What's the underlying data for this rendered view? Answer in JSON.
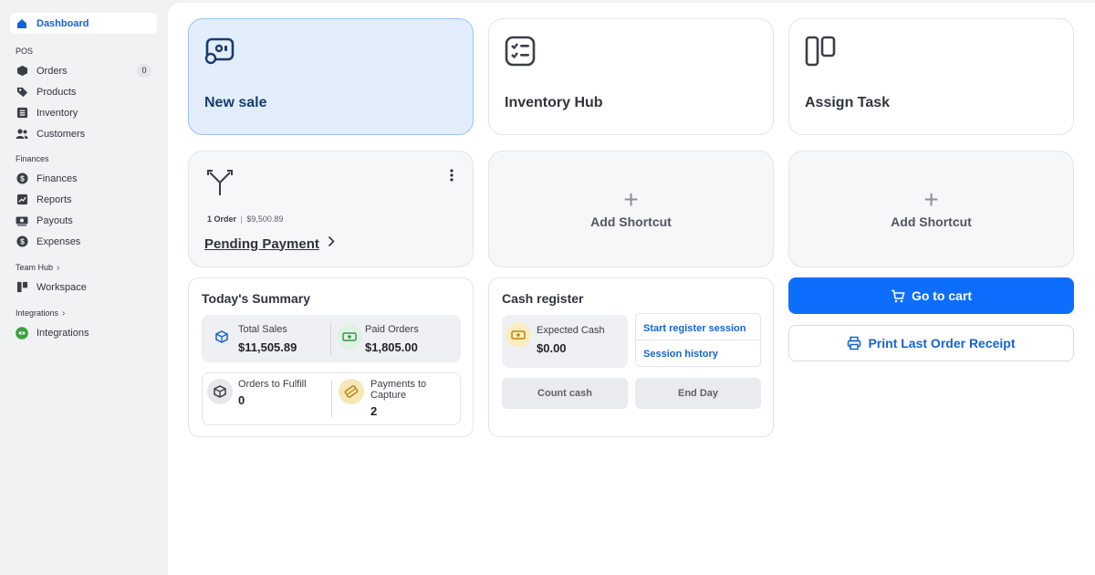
{
  "sidebar": {
    "dashboard": "Dashboard",
    "pos_section": "POS",
    "orders": "Orders",
    "orders_count": "0",
    "products": "Products",
    "inventory": "Inventory",
    "customers": "Customers",
    "finances_section": "Finances",
    "finances": "Finances",
    "reports": "Reports",
    "payouts": "Payouts",
    "expenses": "Expenses",
    "team_section": "Team Hub",
    "workspace": "Workspace",
    "integrations_section": "Integrations",
    "integrations": "Integrations"
  },
  "tiles": {
    "new_sale": "New sale",
    "inventory_hub": "Inventory Hub",
    "assign_task": "Assign Task"
  },
  "pending": {
    "count": "1 Order",
    "amount": "$9,500.89",
    "label": "Pending Payment"
  },
  "shortcut_label": "Add Shortcut",
  "summary": {
    "title": "Today's Summary",
    "total_sales_label": "Total Sales",
    "total_sales_value": "$11,505.89",
    "paid_orders_label": "Paid Orders",
    "paid_orders_value": "$1,805.00",
    "to_fulfill_label": "Orders to Fulfill",
    "to_fulfill_value": "0",
    "to_capture_label": "Payments to Capture",
    "to_capture_value": "2"
  },
  "register": {
    "title": "Cash register",
    "expected_label": "Expected Cash",
    "expected_value": "$0.00",
    "start_session": "Start register session",
    "session_history": "Session history",
    "count_cash": "Count cash",
    "end_day": "End Day"
  },
  "actions": {
    "go_to_cart": "Go to cart",
    "print_receipt": "Print Last Order Receipt"
  },
  "colors": {
    "accent": "#0d6efd",
    "active_tile": "#e3eefc",
    "brand_text": "#1463d6"
  }
}
